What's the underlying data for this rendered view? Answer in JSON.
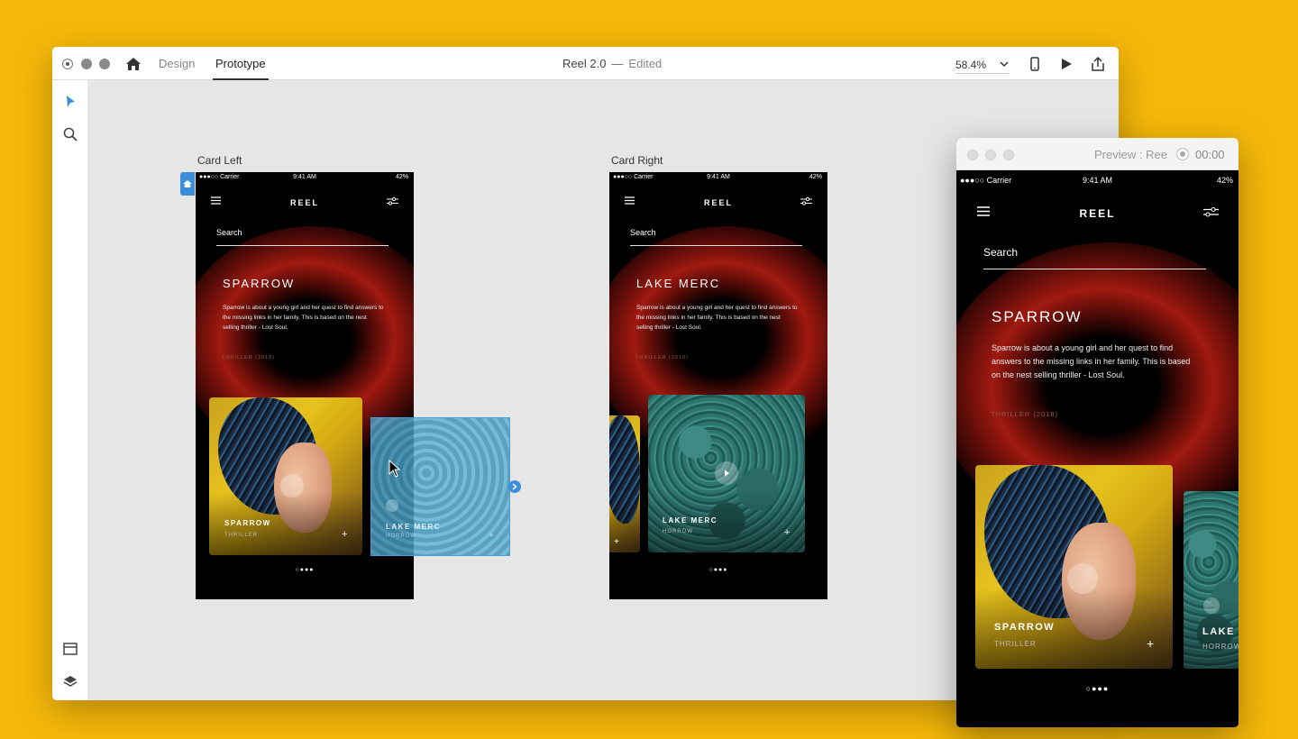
{
  "app": {
    "tabs": {
      "design": "Design",
      "prototype": "Prototype"
    },
    "document": {
      "name": "Reel 2.0",
      "separator": "—",
      "status": "Edited"
    },
    "zoom": "58.4%",
    "icons": [
      "home-icon",
      "device-preview-icon",
      "play-icon",
      "share-icon",
      "select-tool-icon",
      "zoom-tool-icon",
      "assets-panel-icon",
      "layers-panel-icon"
    ]
  },
  "artboards": {
    "left": {
      "label": "Card Left"
    },
    "right": {
      "label": "Card Right"
    }
  },
  "status": {
    "carrier": "●●●○○ Carrier",
    "time": "9:41 AM",
    "battery": "42%"
  },
  "screen": {
    "brand": "REEL",
    "search": "Search",
    "description": "Sparrow is about a young girl and her quest to find answers to the missing links in her family. This is based on the nest selling thriller - Lost Soul.",
    "genre_line": "THRILLER (2018)",
    "plus": "+",
    "pager": "○●●●"
  },
  "left_screen": {
    "movie": "SPARROW",
    "card1": {
      "title": "SPARROW",
      "sub": "THRILLER"
    },
    "card2": {
      "title": "LAKE MERC",
      "sub": "HORROW"
    }
  },
  "right_screen": {
    "movie": "LAKE MERC",
    "card1": {
      "title": "LAKE MERC",
      "sub": "HORROW"
    }
  },
  "preview": {
    "title": "Preview : Ree",
    "time": "00:00",
    "movie": "SPARROW",
    "card1": {
      "title": "SPARROW",
      "sub": "THRILLER"
    },
    "card2": {
      "title": "LAKE",
      "sub": "HORROW"
    }
  },
  "colors": {
    "background": "#F5B80A",
    "selection": "#3D8ED8",
    "canvas": "#E6E6E6"
  }
}
